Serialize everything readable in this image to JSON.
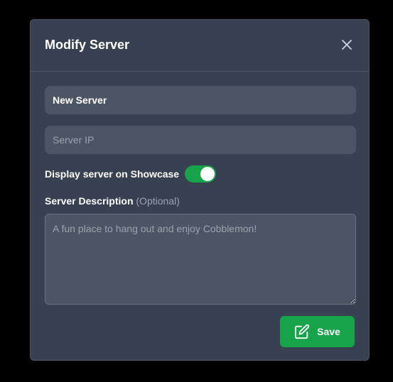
{
  "modal": {
    "title": "Modify Server",
    "close_icon": "close-icon"
  },
  "form": {
    "server_name": {
      "value": "New Server",
      "placeholder": ""
    },
    "server_ip": {
      "value": "",
      "placeholder": "Server IP"
    },
    "showcase_toggle": {
      "label": "Display server on Showcase",
      "enabled": true
    },
    "description": {
      "label": "Server Description",
      "optional_label": "(Optional)",
      "value": "",
      "placeholder": "A fun place to hang out and enjoy Cobblemon!"
    },
    "save_button": {
      "label": "Save",
      "icon": "edit-icon"
    }
  },
  "colors": {
    "background": "#000000",
    "modal_bg": "#374151",
    "input_bg": "#4b5563",
    "accent_green": "#16a34a",
    "muted_text": "#9ca3af"
  }
}
